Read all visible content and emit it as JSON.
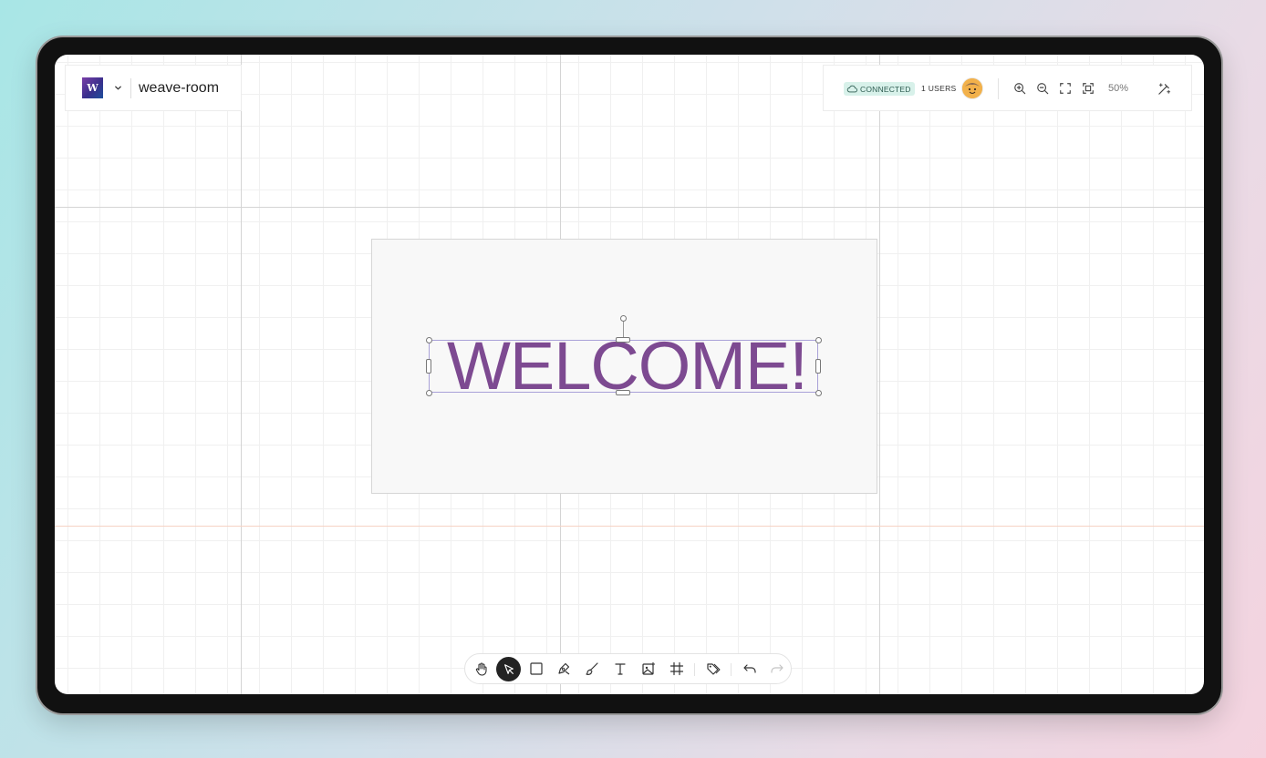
{
  "app": {
    "logo_letter": "W",
    "room_name": "weave-room"
  },
  "status": {
    "connection_label": "CONNECTED",
    "users_label": "1 USERS",
    "zoom_level": "50%"
  },
  "canvas": {
    "text_content": "WELCOME!",
    "text_color": "#7d4a91",
    "selection_color": "#a9a1d8"
  },
  "toolbar": {
    "tools": [
      "hand-tool",
      "select-tool",
      "rectangle-tool",
      "pen-tool",
      "brush-tool",
      "text-tool",
      "image-tool",
      "frame-tool",
      "tag-tool",
      "undo",
      "redo"
    ],
    "active_tool": "select-tool"
  },
  "colors": {
    "badge_bg": "#d8f1ea",
    "active_tool_bg": "#232323"
  }
}
